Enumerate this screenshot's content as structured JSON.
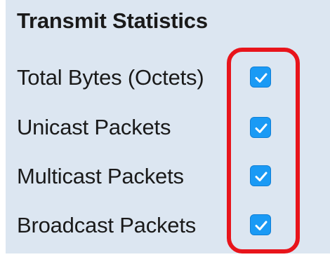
{
  "section": {
    "title": "Transmit Statistics"
  },
  "rows": [
    {
      "label": "Total Bytes (Octets)",
      "checked": true
    },
    {
      "label": "Unicast Packets",
      "checked": true
    },
    {
      "label": "Multicast Packets",
      "checked": true
    },
    {
      "label": "Broadcast Packets",
      "checked": true
    }
  ],
  "colors": {
    "panel_background": "#dce6f1",
    "checkbox_fill": "#1a9af5",
    "highlight_border": "#e8141b"
  }
}
